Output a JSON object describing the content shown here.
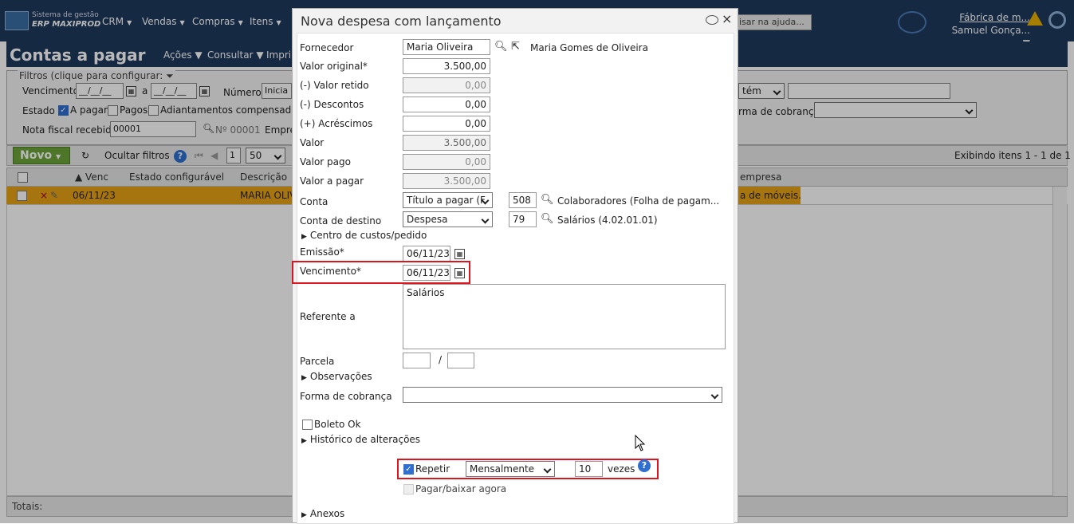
{
  "app": {
    "logo_line1": "Sistema de gestão",
    "logo_line2": "ERP MAXIPROD",
    "top_menu": [
      "CRM",
      "Vendas",
      "Compras",
      "Itens"
    ],
    "help_search": "isar na ajuda...",
    "company": "Fábrica de m...",
    "user": "Samuel Gonça..."
  },
  "page": {
    "title": "Contas a pagar",
    "submenu": [
      "Ações",
      "Consultar",
      "Impri"
    ]
  },
  "filters": {
    "legend": "Filtros (clique para configurar:",
    "vencimento_label": "Vencimento",
    "vencimento_from": "__/__/__",
    "a_label": "a",
    "vencimento_to": "__/__/__",
    "numero_label": "Número",
    "numero_value": "Inicia",
    "estado_label": "Estado",
    "a_pagar": "A pagar",
    "pagos": "Pagos",
    "adiantamentos": "Adiantamentos compensados",
    "nota_fiscal_label": "Nota fiscal recebida",
    "nota_fiscal_value": "00001",
    "nf_result": "Nº 00001",
    "empresa_label": "Empre",
    "contem_select": "tém",
    "forma_cobranca_label": "rma de cobrança"
  },
  "toolbar": {
    "novo": "Novo",
    "ocultar": "Ocultar filtros",
    "page": "1",
    "per_page": "50",
    "exibindo": "Exibindo itens 1 - 1 de 1"
  },
  "grid": {
    "headers": [
      "Venc",
      "Estado configurável",
      "Descrição",
      "empresa"
    ],
    "row": {
      "venc": "06/11/23",
      "descricao": "MARIA OLIV",
      "empresa": "a de móveis..."
    },
    "totals": "Totais:"
  },
  "dialog": {
    "title": "Nova despesa com lançamento",
    "fornecedor_label": "Fornecedor",
    "fornecedor_value": "Maria Oliveira",
    "fornecedor_link": "Maria Gomes de Oliveira",
    "valor_original_label": "Valor original*",
    "valor_original": "3.500,00",
    "valor_retido_label": "(-) Valor retido",
    "valor_retido": "0,00",
    "descontos_label": "(-) Descontos",
    "descontos": "0,00",
    "acrescimos_label": "(+) Acréscimos",
    "acrescimos": "0,00",
    "valor_label": "Valor",
    "valor": "3.500,00",
    "valor_pago_label": "Valor pago",
    "valor_pago": "0,00",
    "valor_a_pagar_label": "Valor a pagar",
    "valor_a_pagar": "3.500,00",
    "conta_label": "Conta",
    "conta_select": "Título a pagar (F",
    "conta_code": "508",
    "conta_desc": "Colaboradores (Folha de pagam...",
    "conta_destino_label": "Conta de destino",
    "conta_destino_select": "Despesa",
    "conta_destino_code": "79",
    "conta_destino_desc": "Salários (4.02.01.01)",
    "centro_custos": "Centro de custos/pedido",
    "emissao_label": "Emissão*",
    "emissao": "06/11/23",
    "vencimento_label": "Vencimento*",
    "vencimento": "06/11/23",
    "referente_label": "Referente a",
    "referente": "Salários",
    "parcela_label": "Parcela",
    "parcela_sep": "/",
    "observacoes": "Observações",
    "forma_cobranca_label": "Forma de cobrança",
    "boleto_ok": "Boleto Ok",
    "historico": "Histórico de alterações",
    "repetir": "Repetir",
    "repetir_freq": "Mensalmente",
    "repetir_qtd": "10",
    "vezes": "vezes",
    "pagar_agora": "Pagar/baixar agora",
    "anexos": "Anexos"
  },
  "colors": {
    "header": "#1f3a5e",
    "highlight": "#e0141e",
    "row": "#e8a317",
    "novo": "#6ba43a"
  }
}
